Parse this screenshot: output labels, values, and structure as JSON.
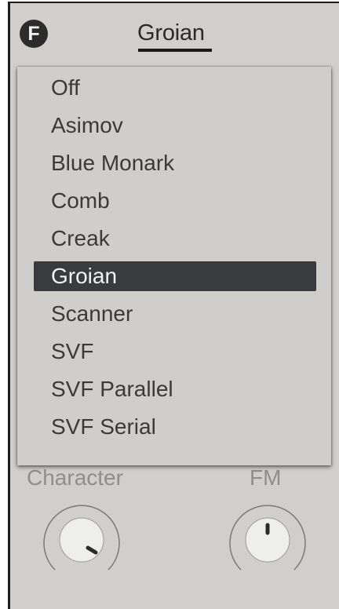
{
  "header": {
    "badge": "F",
    "title": "Groian"
  },
  "menu": {
    "items": [
      {
        "label": "Off"
      },
      {
        "label": "Asimov"
      },
      {
        "label": "Blue Monark"
      },
      {
        "label": "Comb"
      },
      {
        "label": "Creak"
      },
      {
        "label": "Groian",
        "selected": true
      },
      {
        "label": "Scanner"
      },
      {
        "label": "SVF"
      },
      {
        "label": "SVF Parallel"
      },
      {
        "label": "SVF Serial"
      }
    ]
  },
  "knobs": {
    "character": {
      "label": "Character"
    },
    "fm": {
      "label": "FM"
    }
  },
  "colors": {
    "panel": "#d0cfcb",
    "selected_bg": "#3a3b3d",
    "selected_text": "#f2f2f2",
    "text": "#3a3a3a",
    "knob_label": "#8f8e8b"
  }
}
